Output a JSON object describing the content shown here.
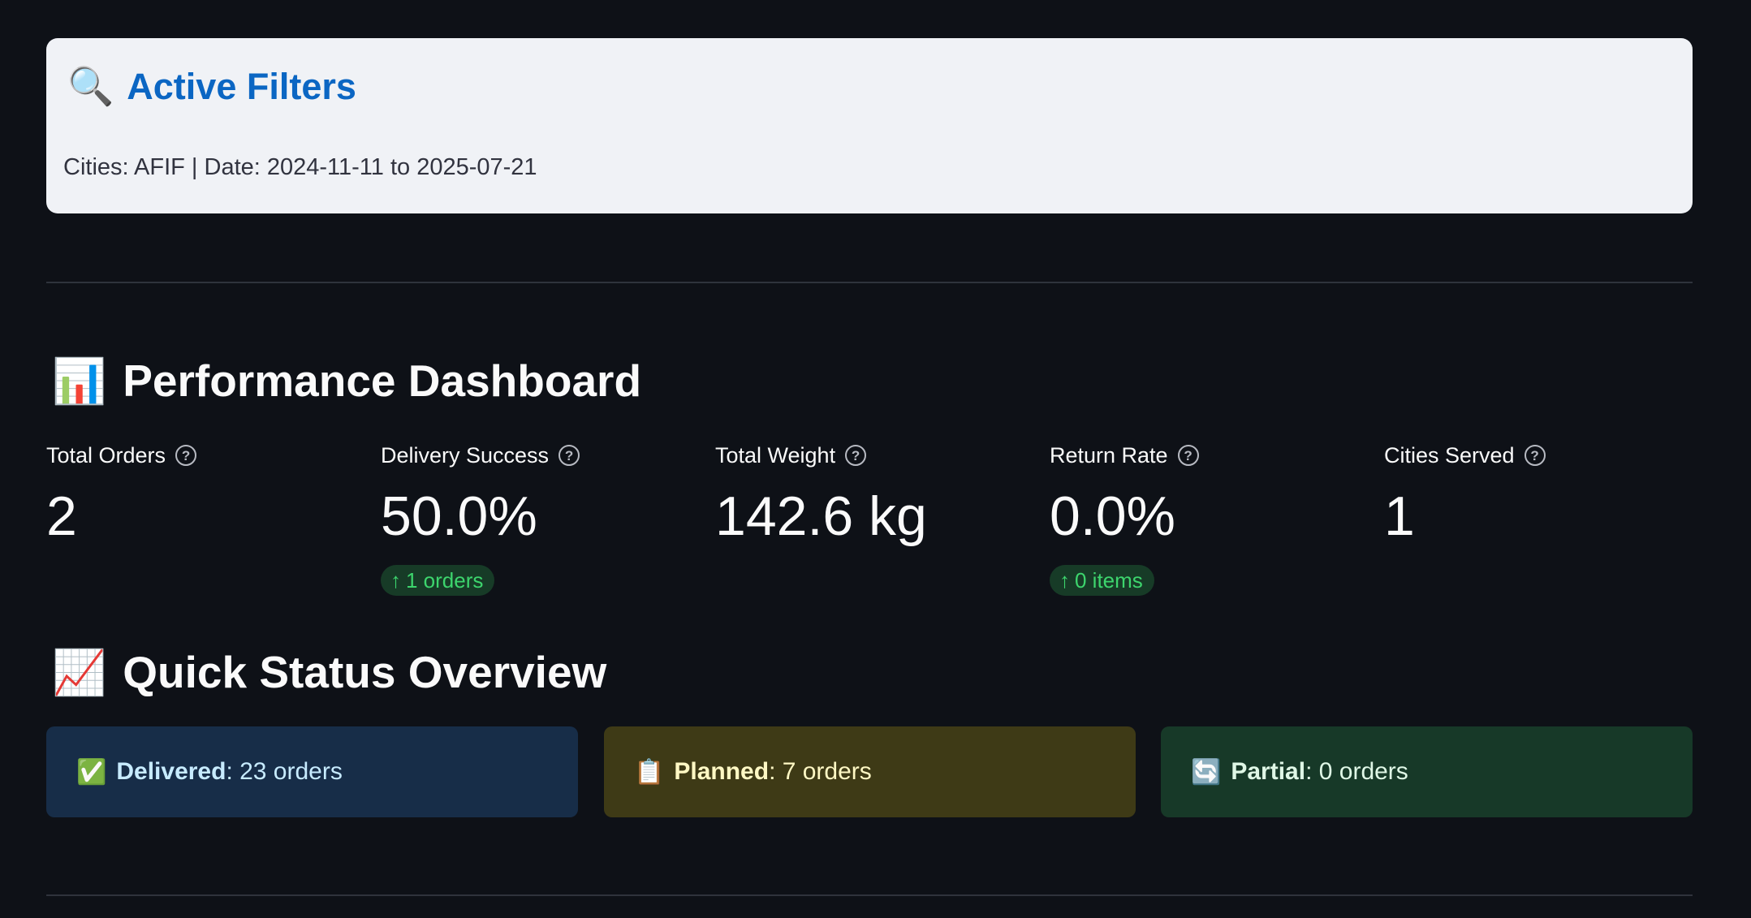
{
  "filters": {
    "icon": "magnifier-icon",
    "title": "Active Filters",
    "text": "Cities: AFIF | Date: 2024-11-11 to 2025-07-21"
  },
  "performance": {
    "icon": "bar-chart-icon",
    "title": "Performance Dashboard",
    "metrics": [
      {
        "label": "Total Orders",
        "value": "2",
        "delta": null
      },
      {
        "label": "Delivery Success",
        "value": "50.0%",
        "delta": "1 orders"
      },
      {
        "label": "Total Weight",
        "value": "142.6 kg",
        "delta": null
      },
      {
        "label": "Return Rate",
        "value": "0.0%",
        "delta": "0 items"
      },
      {
        "label": "Cities Served",
        "value": "1",
        "delta": null
      }
    ]
  },
  "status": {
    "icon": "trend-up-chart-icon",
    "title": "Quick Status Overview",
    "cards": [
      {
        "icon": "check-mark-icon",
        "label": "Delivered",
        "value": ": 23 orders",
        "color": "#172d48"
      },
      {
        "icon": "clipboard-icon",
        "label": "Planned",
        "value": ": 7 orders",
        "color": "#3e3a16"
      },
      {
        "icon": "refresh-icon",
        "label": "Partial",
        "value": ": 0 orders",
        "color": "#173928"
      }
    ]
  },
  "colors": {
    "background": "#0e1117",
    "accent_blue": "#0b66c3",
    "delta_green": "#3dd56d"
  }
}
